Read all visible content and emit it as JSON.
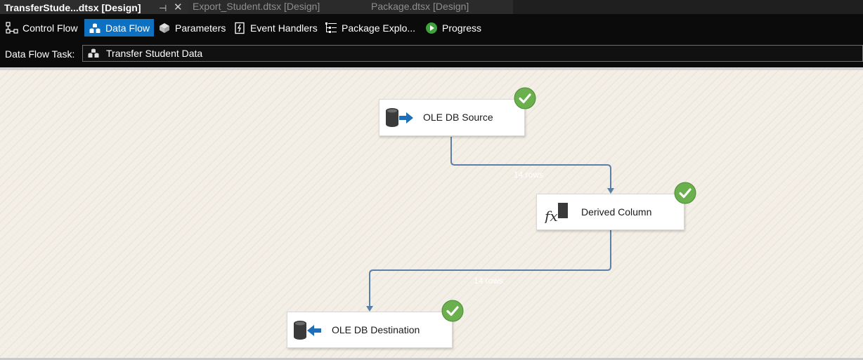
{
  "tabs": [
    {
      "label": "TransferStude...dtsx [Design]",
      "active": true
    },
    {
      "label": "Export_Student.dtsx [Design]",
      "active": false
    },
    {
      "label": "Package.dtsx [Design]",
      "active": false
    }
  ],
  "toolbar": {
    "items": [
      {
        "label": "Control Flow",
        "icon": "control-flow-icon",
        "selected": false
      },
      {
        "label": "Data Flow",
        "icon": "data-flow-icon",
        "selected": true
      },
      {
        "label": "Parameters",
        "icon": "parameters-icon",
        "selected": false
      },
      {
        "label": "Event Handlers",
        "icon": "event-handlers-icon",
        "selected": false
      },
      {
        "label": "Package Explo...",
        "icon": "package-explorer-icon",
        "selected": false
      },
      {
        "label": "Progress",
        "icon": "progress-play-icon",
        "selected": false
      }
    ]
  },
  "task_selector": {
    "label": "Data Flow Task:",
    "value": "Transfer Student Data"
  },
  "nodes": [
    {
      "label": "OLE DB Source",
      "icon": "ole-db-source-icon",
      "status": "success"
    },
    {
      "label": "Derived Column",
      "icon": "derived-column-icon",
      "status": "success"
    },
    {
      "label": "OLE DB Destination",
      "icon": "ole-db-destination-icon",
      "status": "success"
    }
  ],
  "flows": [
    {
      "label": "14 rows"
    },
    {
      "label": "14 rows"
    }
  ],
  "colors": {
    "selected_tab_accent": "#0e70c0",
    "canvas": "#f3efe6",
    "path": "#5b7fa6",
    "success": "#6ab04c"
  }
}
